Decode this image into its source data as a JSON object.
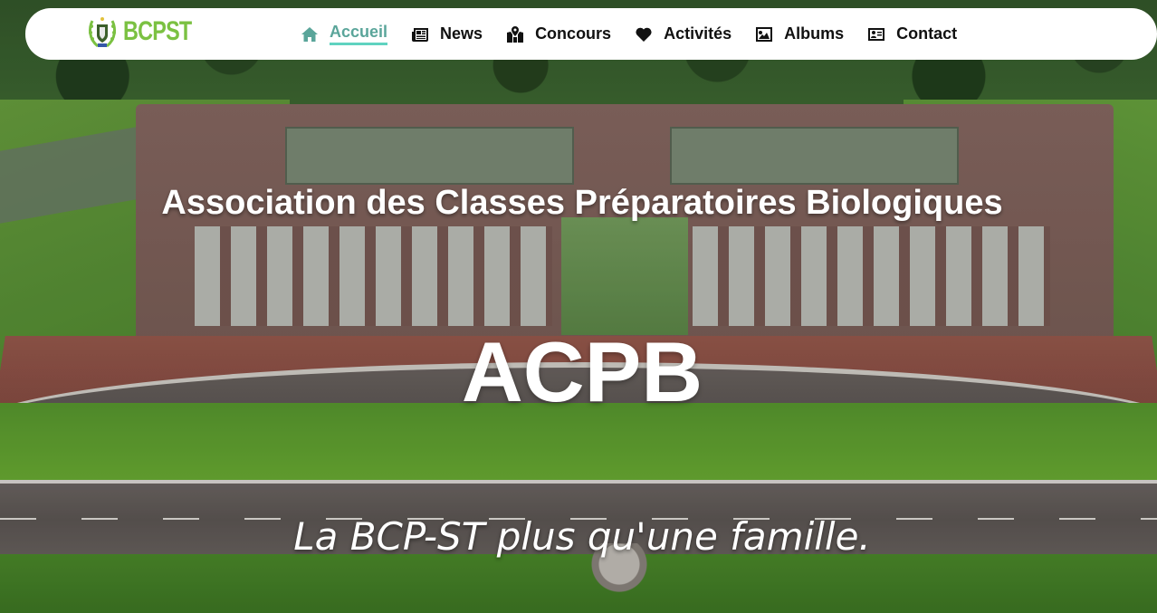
{
  "navbar": {
    "logo_text": "BCPST",
    "logo_icon": "laurel-shield-emblem",
    "items": [
      {
        "label": "Accueil",
        "icon": "home-icon",
        "active": true
      },
      {
        "label": "News",
        "icon": "newspaper-icon",
        "active": false
      },
      {
        "label": "Concours",
        "icon": "map-location-icon",
        "active": false
      },
      {
        "label": "Activités",
        "icon": "heart-icon",
        "active": false
      },
      {
        "label": "Albums",
        "icon": "image-icon",
        "active": false
      },
      {
        "label": "Contact",
        "icon": "id-card-icon",
        "active": false
      }
    ],
    "active_color": "#5aa59a",
    "underline_color": "#5fd3c0"
  },
  "hero": {
    "subtitle": "Association des Classes Préparatoires Biologiques",
    "title": "ACPB",
    "tagline": "La BCP-ST plus qu'une famille.",
    "background": "aerial-campus-photo"
  }
}
